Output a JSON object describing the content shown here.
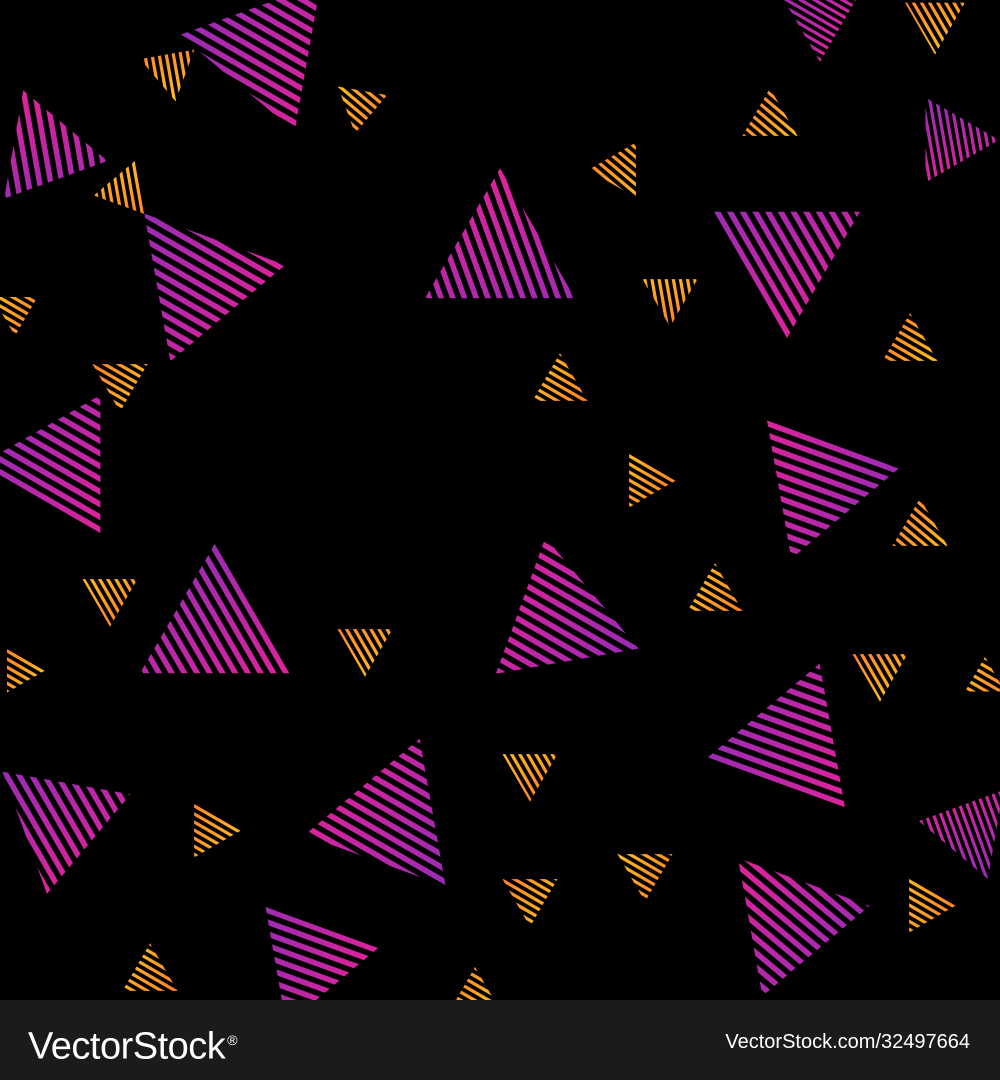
{
  "artwork": {
    "description_colors": {
      "background": "#000000",
      "gradient_pink": "#ff1f8e",
      "gradient_purple": "#7b2fbf",
      "gradient_orange": "#ff6a2b",
      "gradient_yellow": "#ffd21f"
    },
    "motif": "striped-triangles"
  },
  "footer": {
    "background": "#1b1b1b",
    "watermark": "VectorStock",
    "image_id": "VectorStock.com/32497664"
  }
}
